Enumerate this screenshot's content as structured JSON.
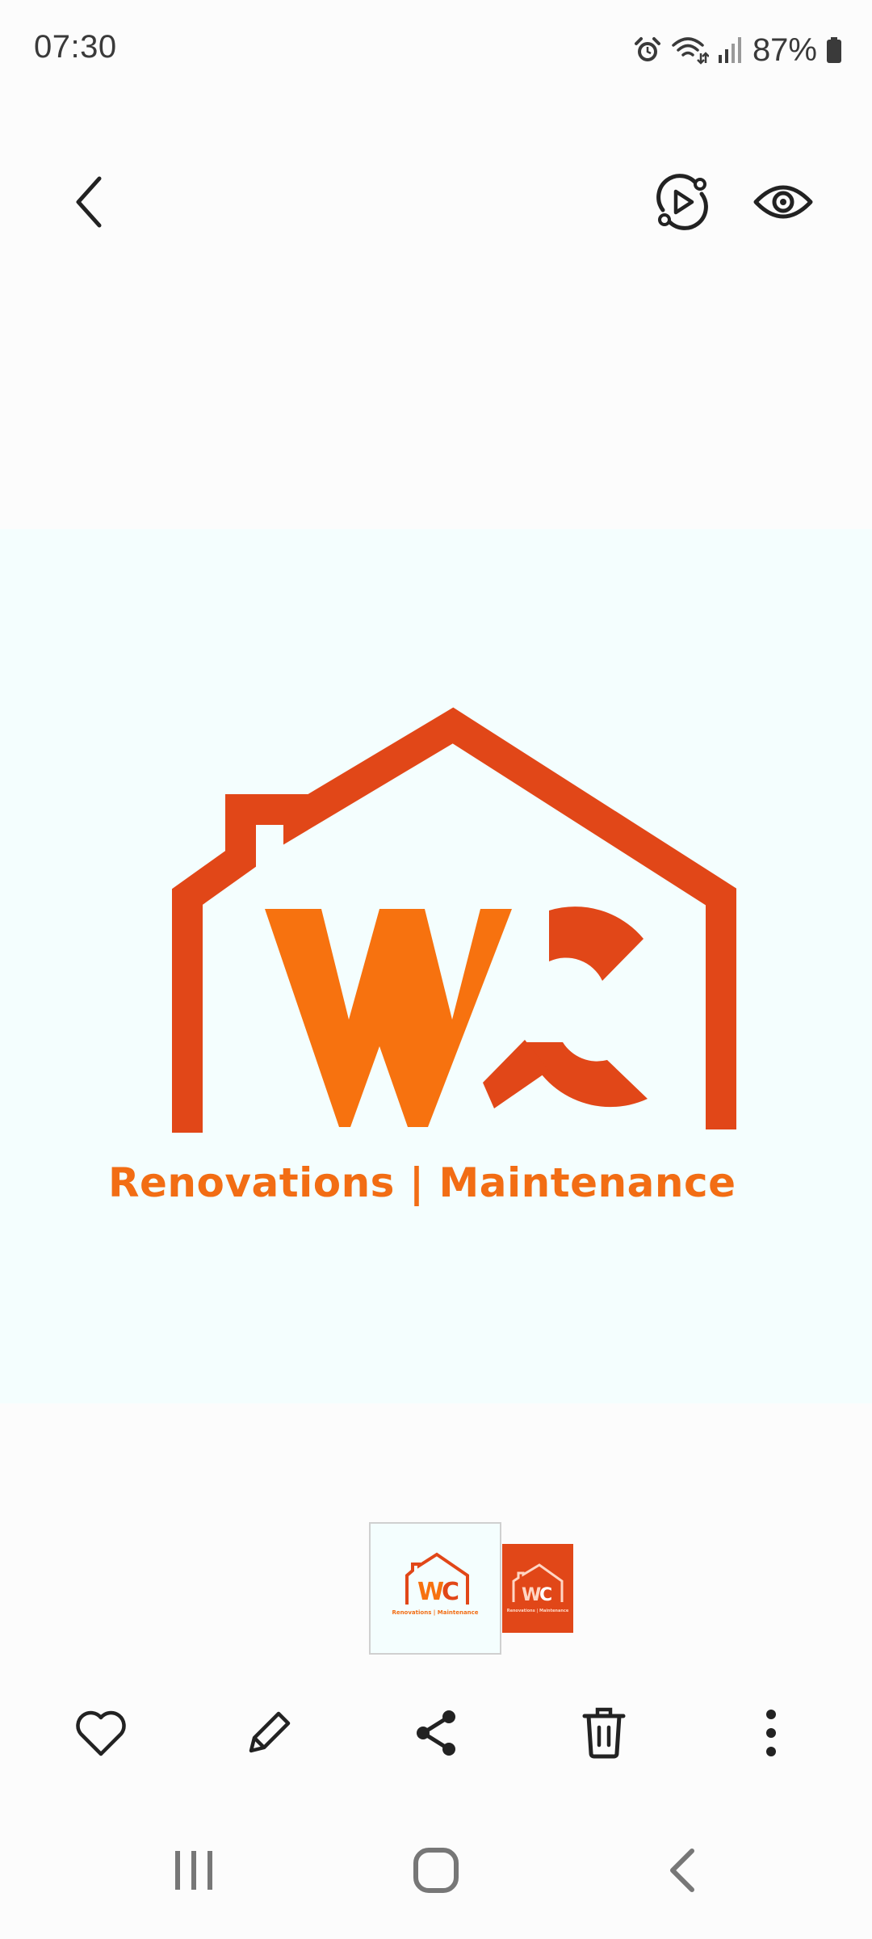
{
  "status_bar": {
    "time": "07:30",
    "battery_percent": "87%",
    "icons": [
      "alarm-icon",
      "wifi-icon",
      "signal-icon",
      "battery-icon"
    ]
  },
  "top_bar": {
    "back": {
      "icon": "back-arrow-icon"
    },
    "actions": [
      {
        "icon": "remaster-play-icon"
      },
      {
        "icon": "eye-icon"
      }
    ]
  },
  "image": {
    "logo_letters": "WC",
    "tagline": "Renovations | Maintenance",
    "colors": {
      "roof": "#e14718",
      "w_letter": "#f7720f",
      "c_letter": "#e14718",
      "tagline": "#f26d14",
      "background": "#f4fefe"
    }
  },
  "thumbnails": [
    {
      "caption": "Renovations | Maintenance",
      "selected": true
    },
    {
      "caption": "Renovations | Maintenance",
      "selected": false
    }
  ],
  "bottom_bar": {
    "actions": [
      {
        "icon": "heart-icon"
      },
      {
        "icon": "edit-pencil-icon"
      },
      {
        "icon": "share-icon"
      },
      {
        "icon": "delete-icon"
      },
      {
        "icon": "more-options-icon"
      }
    ]
  },
  "nav_bar": {
    "buttons": [
      {
        "icon": "recent-apps-icon"
      },
      {
        "icon": "home-icon"
      },
      {
        "icon": "back-icon"
      }
    ]
  }
}
